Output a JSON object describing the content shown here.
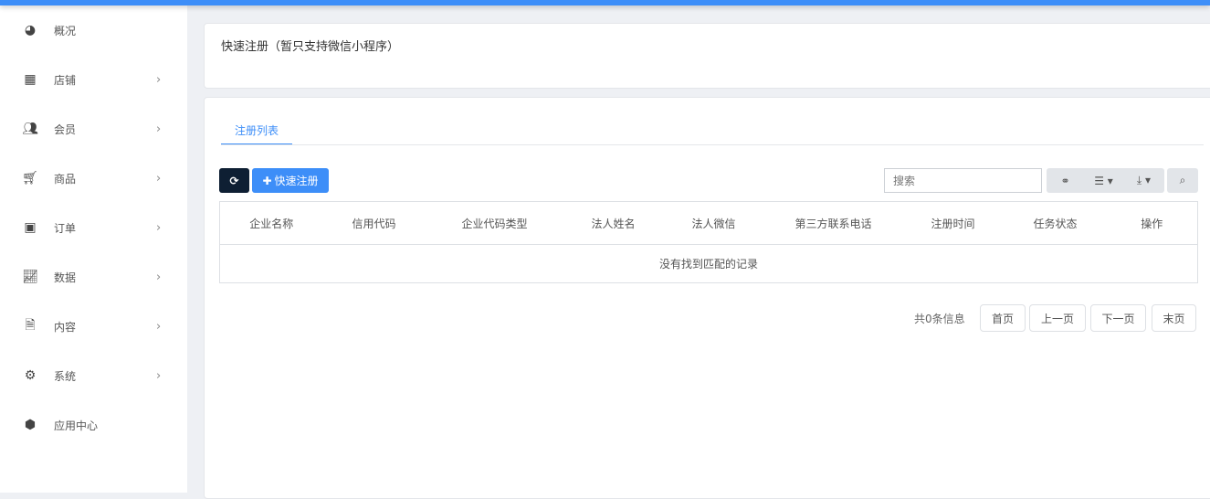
{
  "sidebar": {
    "items": [
      {
        "label": "概况",
        "icon": "dashboard-icon",
        "chevron": false
      },
      {
        "label": "店铺",
        "icon": "grid-icon",
        "chevron": true
      },
      {
        "label": "会员",
        "icon": "users-icon",
        "chevron": true
      },
      {
        "label": "商品",
        "icon": "cart-icon",
        "chevron": true
      },
      {
        "label": "订单",
        "icon": "money-icon",
        "chevron": true
      },
      {
        "label": "数据",
        "icon": "chart-icon",
        "chevron": true
      },
      {
        "label": "内容",
        "icon": "document-icon",
        "chevron": true
      },
      {
        "label": "系统",
        "icon": "gear-icon",
        "chevron": true
      },
      {
        "label": "应用中心",
        "icon": "cube-icon",
        "chevron": false
      }
    ]
  },
  "header": {
    "title": "快速注册（暂只支持微信小程序）"
  },
  "main": {
    "tab": "注册列表",
    "add_button": "快速注册",
    "search_placeholder": "搜索",
    "columns": [
      "企业名称",
      "信用代码",
      "企业代码类型",
      "法人姓名",
      "法人微信",
      "第三方联系电话",
      "注册时间",
      "任务状态",
      "操作"
    ],
    "empty_text": "没有找到匹配的记录",
    "total": "共0条信息",
    "pager": {
      "first": "首页",
      "prev": "上一页",
      "next": "下一页",
      "last": "末页"
    }
  },
  "colors": {
    "accent": "#3d8ef8",
    "dark": "#0e1f33"
  }
}
